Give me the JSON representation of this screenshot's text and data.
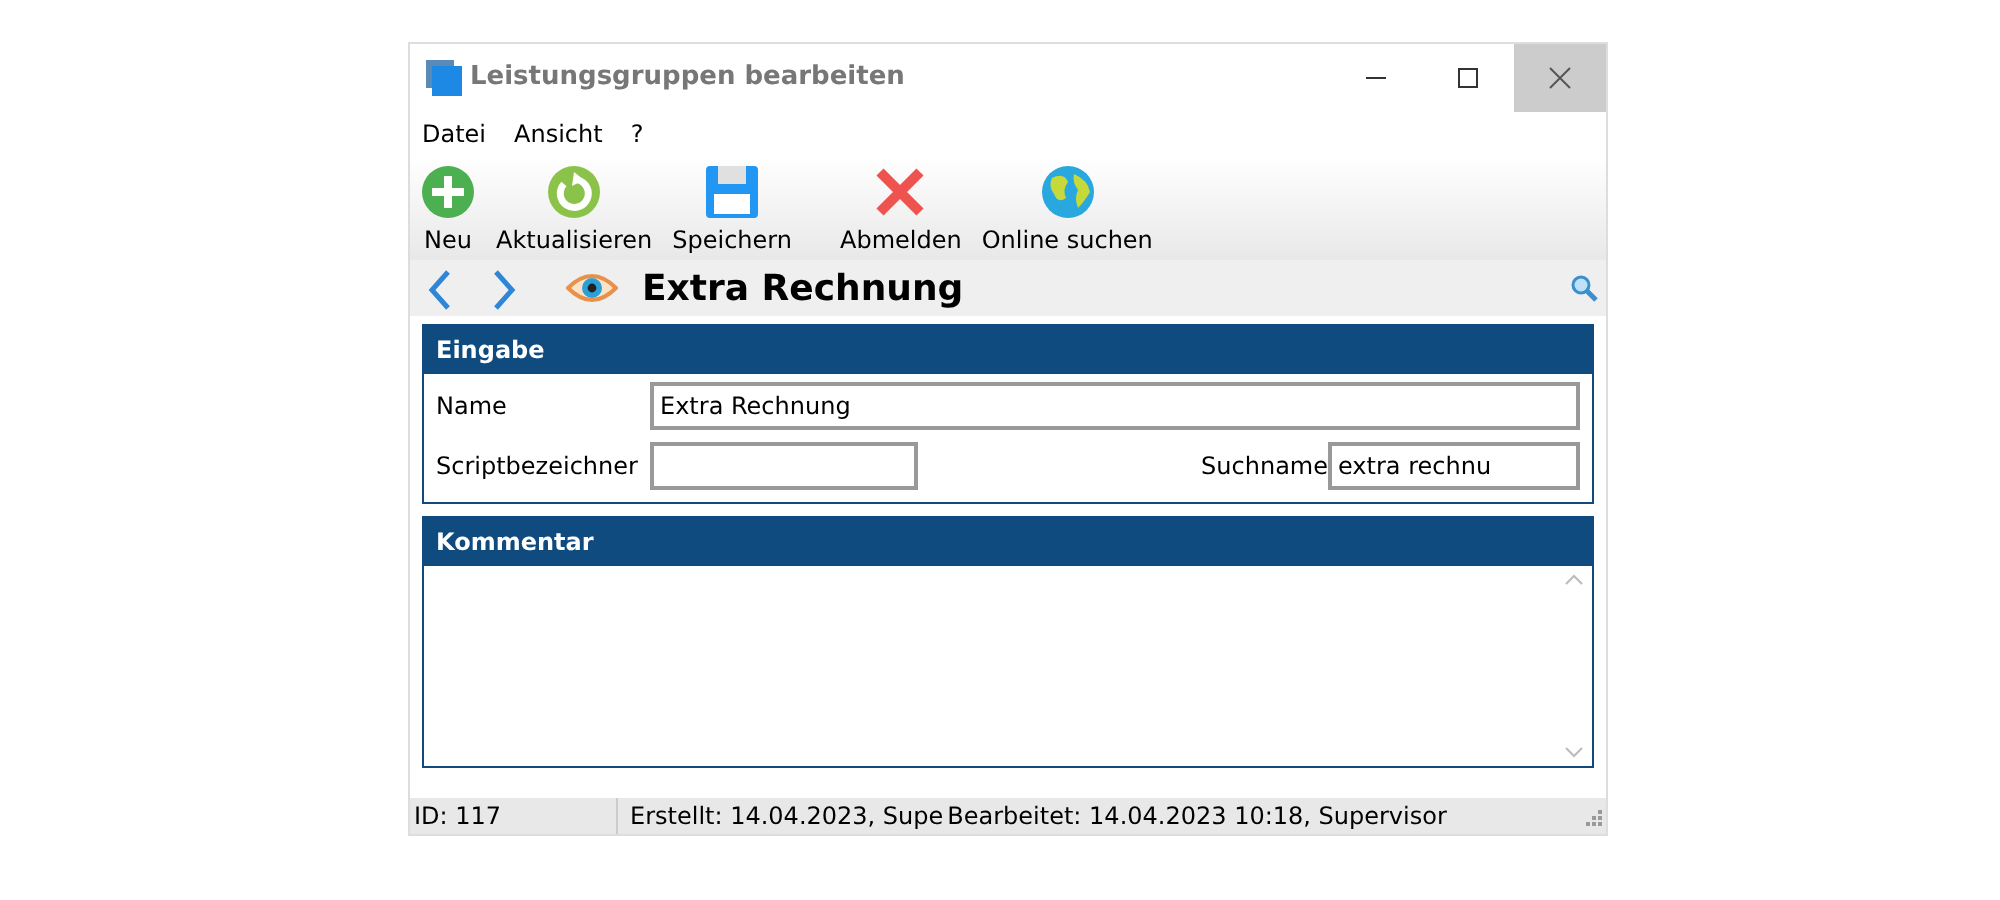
{
  "window": {
    "title": "Leistungsgruppen bearbeiten"
  },
  "menu": [
    "Datei",
    "Ansicht",
    "?"
  ],
  "toolbar": [
    {
      "kind": "add",
      "label": "Neu"
    },
    {
      "kind": "refresh",
      "label": "Aktualisieren"
    },
    {
      "kind": "save",
      "label": "Speichern"
    },
    {
      "kind": "delete",
      "label": "Abmelden"
    },
    {
      "kind": "globe",
      "label": "Online suchen"
    }
  ],
  "record_title": "Extra Rechnung",
  "eingabe": {
    "title": "Eingabe",
    "name_label": "Name",
    "name_value": "Extra Rechnung",
    "script_label": "Scriptbezeichner",
    "suchname_label": "Suchname",
    "suchname_value": "extra rechnu"
  },
  "kommentar": {
    "title": "Kommentar"
  },
  "status_bar": [
    "ID: 117",
    "Erstellt: 14.04.2023, Supe",
    "Bearbeitet: 14.04.2023 10:18, Supervisor"
  ]
}
